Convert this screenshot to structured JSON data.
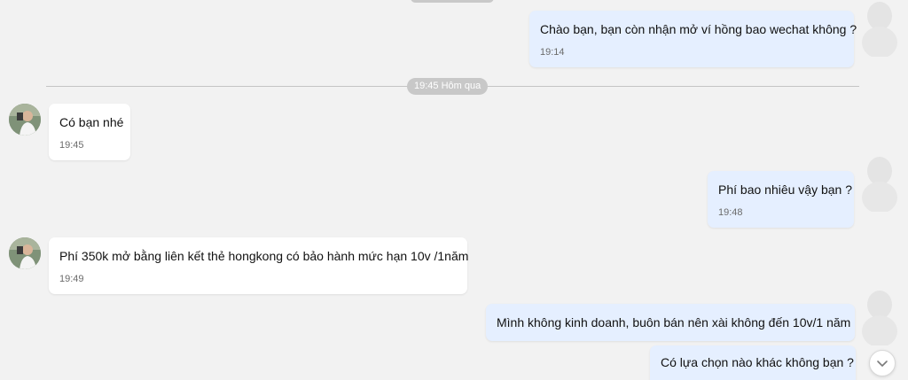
{
  "divider": {
    "label": "19:45 Hôm qua"
  },
  "messages": [
    {
      "direction": "out",
      "text": "Chào bạn, bạn còn nhận mở ví hồng bao wechat không ?",
      "time": "19:14"
    },
    {
      "direction": "in",
      "text": "Có bạn nhé",
      "time": "19:45"
    },
    {
      "direction": "out",
      "text": "Phí bao nhiêu vậy bạn ?",
      "time": "19:48"
    },
    {
      "direction": "in",
      "text": "Phí 350k mở bằng liên kết thẻ hongkong có bảo hành mức hạn 10v /1năm",
      "time": "19:49"
    },
    {
      "direction": "out",
      "text": "Mình không kinh doanh, buôn bán nên xài không đến 10v/1 năm",
      "time": ""
    },
    {
      "direction": "out",
      "text": "Có lựa chọn nào khác không bạn ?",
      "time": ""
    }
  ],
  "icons": {
    "scroll_down": "chevron-down-icon",
    "avatar_contact": "avatar",
    "avatar_self": "avatar"
  },
  "colors": {
    "background": "#f2f2f2",
    "incoming_bubble": "#ffffff",
    "outgoing_bubble": "#e5efff",
    "time_text": "#6b6b6b"
  }
}
